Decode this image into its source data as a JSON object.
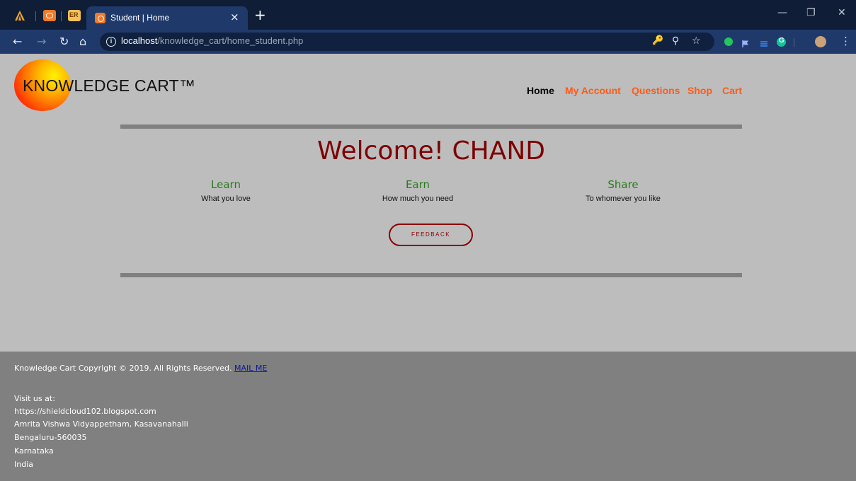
{
  "browser": {
    "pinned_tabs": [
      {
        "name": "pinned-tab-1",
        "color": "#f5a623"
      },
      {
        "name": "pinned-tab-2",
        "color": "#f17a28"
      },
      {
        "name": "pinned-tab-3",
        "label": "ER",
        "color": "#f3c35a"
      }
    ],
    "active_tab": {
      "title": "Student | Home",
      "close": "×"
    },
    "new_tab": "+",
    "window_controls": [
      "—",
      "❐",
      "✕"
    ],
    "nav": {
      "back": "←",
      "forward": "→",
      "reload": "↻",
      "home": "⌂"
    },
    "url": {
      "host": "localhost",
      "path": "/knowledge_cart/home_student.php"
    },
    "omnibox_icons": [
      "key-icon",
      "zoom-icon",
      "star-icon"
    ],
    "extensions": [
      "green-dot-icon",
      "flag-icon",
      "layers-icon",
      "grammarly-icon",
      "avatar-icon"
    ]
  },
  "site": {
    "logo": "KNOWLEDGE CART™",
    "nav": [
      {
        "label": "Home",
        "active": true
      },
      {
        "label": "My Account",
        "active": false
      },
      {
        "label": "Questions",
        "active": false
      },
      {
        "label": "Shop",
        "active": false
      },
      {
        "label": "Cart",
        "active": false
      }
    ],
    "welcome": "Welcome! CHAND",
    "columns": [
      {
        "heading": "Learn",
        "sub": "What you love"
      },
      {
        "heading": "Earn",
        "sub": "How much you need"
      },
      {
        "heading": "Share",
        "sub": "To whomever you like"
      }
    ],
    "feedback_button": "FEEDBACK"
  },
  "footer": {
    "copyright": "Knowledge Cart Copyright © 2019. All Rights Reserved.",
    "mail_link": "MAIL ME",
    "visit": "Visit us at:",
    "blog": "https://shieldcloud102.blogspot.com",
    "address1": "Amrita Vishwa Vidyappetham, Kasavanahalli",
    "address2": "Bengaluru-560035",
    "state": "Karnataka",
    "country": "India"
  },
  "colors": {
    "nav_link": "#ff5a16",
    "welcome": "#7d0000",
    "column_heading": "#2a7a1e",
    "footer_bg": "#808080",
    "page_bg": "#bdbdbd"
  }
}
